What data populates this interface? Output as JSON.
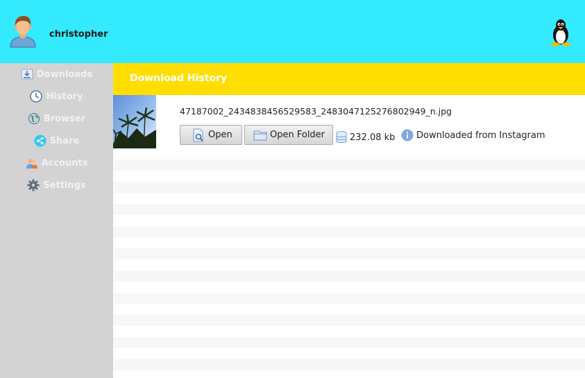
{
  "user": {
    "name": "christopher",
    "avatar_icon": "user-avatar-icon"
  },
  "os_icon": "linux-tux-icon",
  "sidebar": {
    "items": [
      {
        "label": "Downloads",
        "icon": "download-icon"
      },
      {
        "label": "History",
        "icon": "clock-icon"
      },
      {
        "label": "Browser",
        "icon": "globe-icon"
      },
      {
        "label": "Share",
        "icon": "share-icon"
      },
      {
        "label": "Accounts",
        "icon": "accounts-icon"
      },
      {
        "label": "Settings",
        "icon": "gear-icon"
      }
    ]
  },
  "main": {
    "title": "Download History",
    "entries": [
      {
        "filename": "47187002_2434838456529583_2483047125276802949_n.jpg",
        "open_label": "Open",
        "open_folder_label": "Open Folder",
        "size": "232.08 kb",
        "source": "Downloaded from Instagram"
      }
    ]
  },
  "colors": {
    "topbar": "#33eafe",
    "sidebar": "#d3d3d3",
    "header": "#ffde00",
    "stripe": "#f7f7f7"
  }
}
